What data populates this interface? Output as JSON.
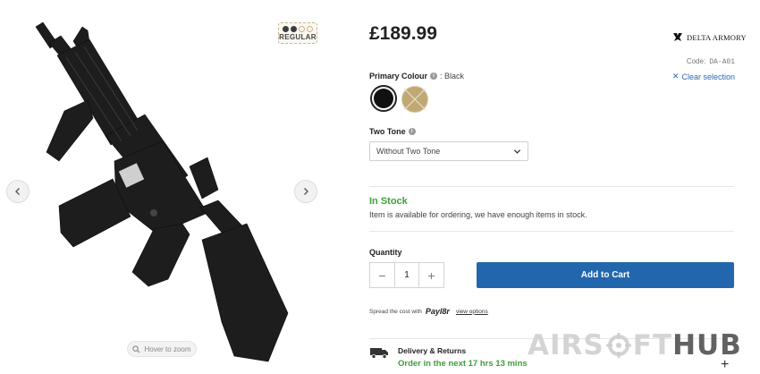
{
  "gallery": {
    "hover_to_zoom": "Hover to zoom",
    "grade_badge": "REGULAR",
    "icons": [
      "chevron-left-icon",
      "chevron-right-icon",
      "zoom-icon",
      "rifle-image"
    ]
  },
  "product": {
    "price": "£189.99",
    "brand": "DELTA ARMORY",
    "code_label": "Code:",
    "code_value": "DA-A01",
    "clear_selection": "Clear selection"
  },
  "options": {
    "primary_colour_label": "Primary Colour",
    "primary_colour_value": ": Black",
    "colours": [
      "Black",
      "Tan"
    ],
    "colour_hex": {
      "black": "#111111",
      "tan": "#bfa874"
    },
    "two_tone_label": "Two Tone",
    "two_tone_selected": "Without Two Tone"
  },
  "stock": {
    "status": "In Stock",
    "description": "Item is available for ordering, we have enough items in stock.",
    "status_color": "#3f9e3a"
  },
  "purchase": {
    "quantity_label": "Quantity",
    "quantity": "1",
    "add_to_cart": "Add to Cart",
    "button_color": "#2266ae"
  },
  "finance": {
    "spread_text": "Spread the cost with",
    "provider": "Payl8r",
    "view_options": "view options"
  },
  "delivery": {
    "title": "Delivery & Returns",
    "message": "Order in the next 17 hrs 13 mins"
  },
  "watermark": {
    "part1": "AIRS",
    "part2": "FT",
    "part3": "HUB"
  }
}
